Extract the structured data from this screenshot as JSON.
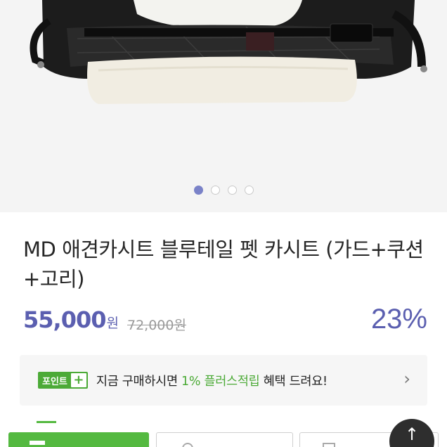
{
  "gallery": {
    "image_description": "pet car seat product photo",
    "dot_count": 4,
    "active_index": 0
  },
  "product": {
    "title": "MD 애견카시트 블루테일 펫 카시트 (가드+쿠션+고리)",
    "sale_price": "55,000",
    "sale_unit": "원",
    "original_price": "72,000원",
    "discount": "23%"
  },
  "point_banner": {
    "badge_label": "포인트",
    "badge_plus": "+",
    "text_before": "지금 구매하시면 ",
    "text_highlight": "1% 플러스적립",
    "text_after": " 혜택 드려요!",
    "chevron": "›"
  },
  "bottom_bar": {
    "top_button_arrow": "↑"
  },
  "colors": {
    "accent_purple": "#5b5fb0",
    "point_green": "#4caa37",
    "dot_active": "#7a82c8"
  }
}
